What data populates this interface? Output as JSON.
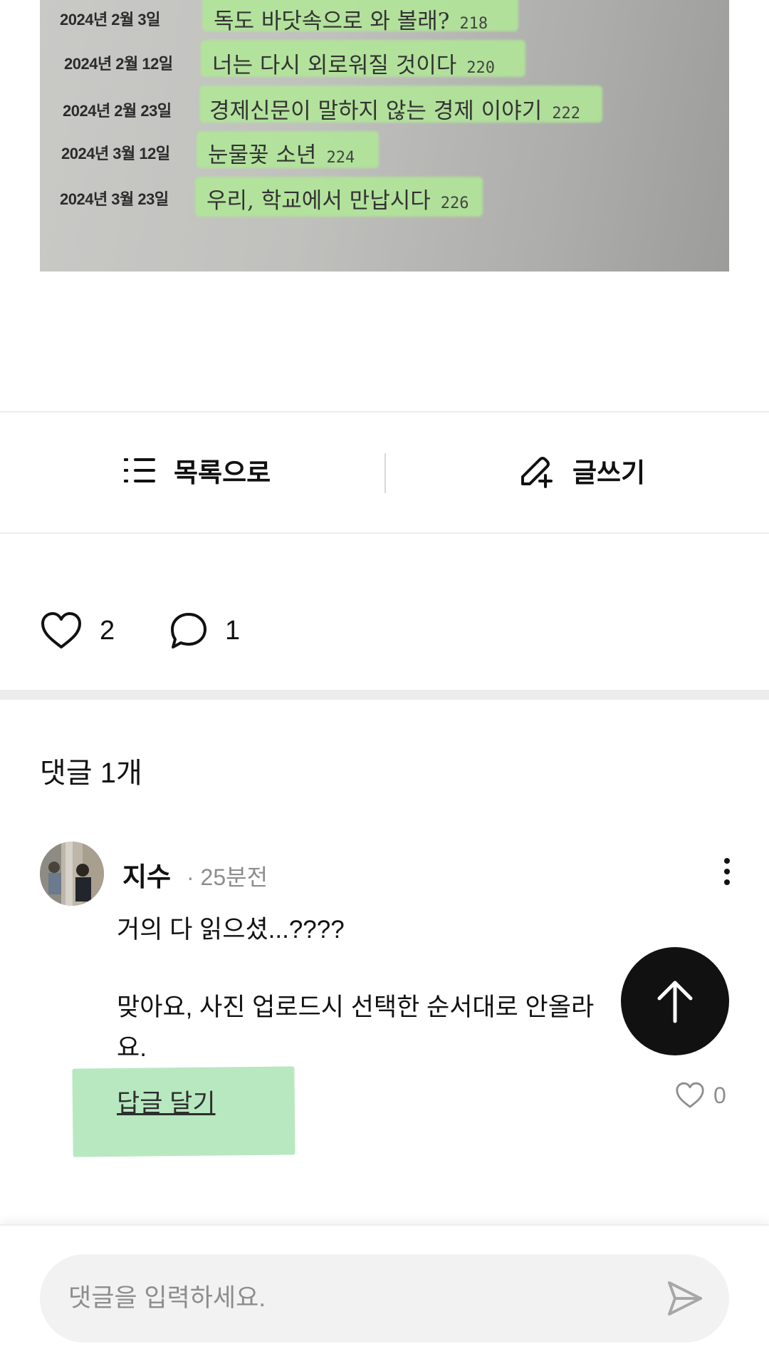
{
  "photo": {
    "rows": [
      {
        "date": "2024년 2월 3일",
        "title": "독도 바닷속으로 와 볼래?",
        "page": "218"
      },
      {
        "date": "2024년 2월 12일",
        "title": "너는 다시 외로워질 것이다",
        "page": "220"
      },
      {
        "date": "2024년 2월 23일",
        "title": "경제신문이 말하지 않는 경제 이야기",
        "page": "222"
      },
      {
        "date": "2024년 3월 12일",
        "title": "눈물꽃 소년",
        "page": "224"
      },
      {
        "date": "2024년 3월 23일",
        "title": "우리, 학교에서 만납시다",
        "page": "226"
      }
    ]
  },
  "nav": {
    "list_label": "목록으로",
    "write_label": "글쓰기"
  },
  "reactions": {
    "likes": "2",
    "comments": "1"
  },
  "comments_section": {
    "title": "댓글 1개",
    "items": [
      {
        "author": "지수",
        "time": "· 25분전",
        "lines": [
          "거의 다 읽으셨...????",
          "",
          "맞아요, 사진 업로드시 선택한 순서대로 안올라",
          "요."
        ],
        "reply_label": "답글 달기",
        "likes": "0"
      }
    ]
  },
  "input": {
    "placeholder": "댓글을 입력하세요."
  },
  "icons": {
    "list": "list-icon",
    "write": "pencil-plus-icon",
    "like": "heart-icon",
    "comment": "speech-bubble-icon",
    "more": "more-vertical-icon",
    "scroll_top": "arrow-up-icon",
    "send": "send-icon"
  },
  "colors": {
    "highlight": "#b8e8c0",
    "muted_text": "#8d8d8d",
    "fab": "#111111",
    "input_bg": "#f2f2f2"
  }
}
